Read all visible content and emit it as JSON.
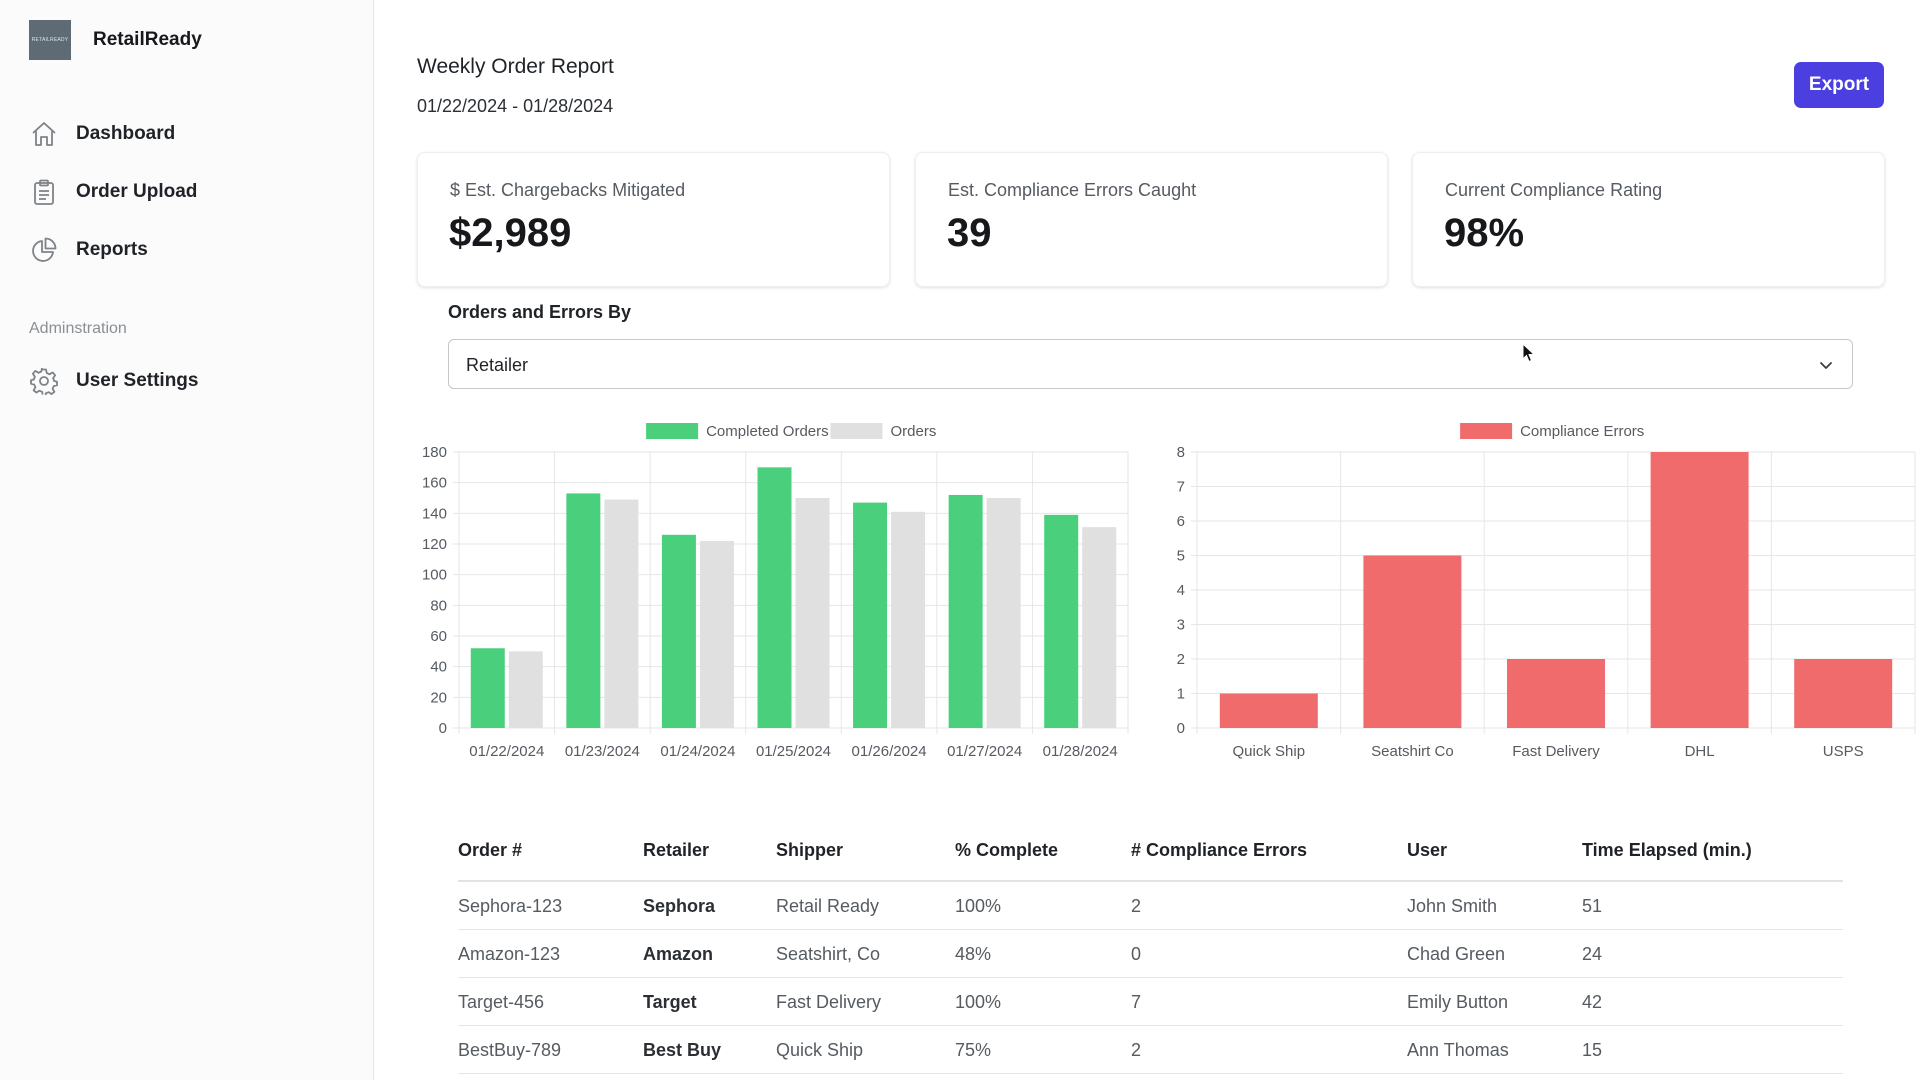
{
  "sidebar": {
    "brand_name": "RetailReady",
    "logo_text": "RETAILREADY",
    "nav": [
      {
        "label": "Dashboard",
        "icon": "home-icon"
      },
      {
        "label": "Order Upload",
        "icon": "clipboard-icon"
      },
      {
        "label": "Reports",
        "icon": "pie-chart-icon"
      }
    ],
    "section_label": "Adminstration",
    "admin_nav": [
      {
        "label": "User Settings",
        "icon": "gear-icon"
      }
    ]
  },
  "header": {
    "title": "Weekly Order Report",
    "date_range": "01/22/2024 - 01/28/2024",
    "export_label": "Export"
  },
  "cards": [
    {
      "label": "$ Est. Chargebacks Mitigated",
      "value": "$2,989"
    },
    {
      "label": "Est. Compliance Errors Caught",
      "value": "39"
    },
    {
      "label": "Current Compliance Rating",
      "value": "98%"
    }
  ],
  "filter": {
    "label": "Orders and Errors By",
    "selected": "Retailer"
  },
  "colors": {
    "accent": "#4b3fe0",
    "completed": "#4ad07c",
    "orders": "#e0e0e0",
    "errors": "#f06b6b"
  },
  "chart_data": [
    {
      "type": "bar",
      "categories": [
        "01/22/2024",
        "01/23/2024",
        "01/24/2024",
        "01/25/2024",
        "01/26/2024",
        "01/27/2024",
        "01/28/2024"
      ],
      "series": [
        {
          "name": "Completed Orders",
          "values": [
            52,
            153,
            126,
            170,
            147,
            152,
            139
          ]
        },
        {
          "name": "Orders",
          "values": [
            50,
            149,
            122,
            150,
            141,
            150,
            131
          ]
        }
      ],
      "ylim": [
        0,
        180
      ],
      "yticks": [
        0,
        20,
        40,
        60,
        80,
        100,
        120,
        140,
        160,
        180
      ],
      "grid": true,
      "legend": "top-center"
    },
    {
      "type": "bar",
      "categories": [
        "Quick Ship",
        "Seatshirt Co",
        "Fast Delivery",
        "DHL",
        "USPS"
      ],
      "series": [
        {
          "name": "Compliance Errors",
          "values": [
            1,
            5,
            2,
            8,
            2
          ]
        }
      ],
      "ylim": [
        0,
        8
      ],
      "yticks": [
        0,
        1,
        2,
        3,
        4,
        5,
        6,
        7,
        8
      ],
      "grid": true,
      "legend": "top-center"
    }
  ],
  "table": {
    "headers": [
      "Order #",
      "Retailer",
      "Shipper",
      "% Complete",
      "# Compliance Errors",
      "User",
      "Time Elapsed (min.)"
    ],
    "rows": [
      [
        "Sephora-123",
        "Sephora",
        "Retail Ready",
        "100%",
        "2",
        "John Smith",
        "51"
      ],
      [
        "Amazon-123",
        "Amazon",
        "Seatshirt, Co",
        "48%",
        "0",
        "Chad Green",
        "24"
      ],
      [
        "Target-456",
        "Target",
        "Fast Delivery",
        "100%",
        "7",
        "Emily Button",
        "42"
      ],
      [
        "BestBuy-789",
        "Best Buy",
        "Quick Ship",
        "75%",
        "2",
        "Ann Thomas",
        "15"
      ]
    ]
  }
}
